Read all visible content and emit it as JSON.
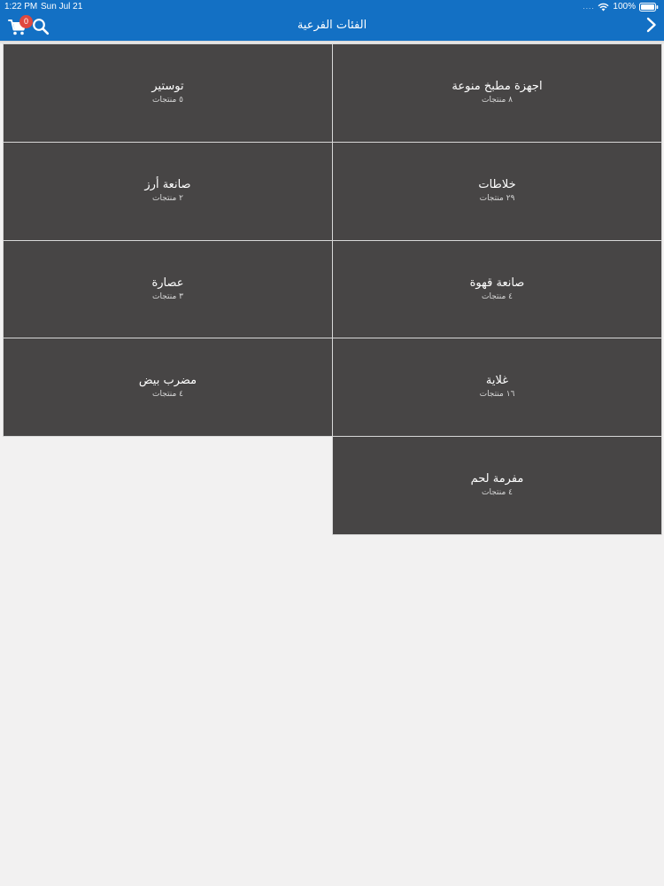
{
  "status": {
    "time": "1:22 PM",
    "date": "Sun Jul 21",
    "signal": "....",
    "battery": "100%"
  },
  "header": {
    "title": "الفئات الفرعية",
    "cart_count": "0"
  },
  "icons": {
    "back": "chevron-right-icon",
    "search": "search-icon",
    "cart": "cart-icon"
  },
  "colors": {
    "accent": "#1370c4",
    "tile": "#474545",
    "badge": "#e0483e",
    "background": "#f2f1f1"
  },
  "categories": [
    {
      "name": "اجهزة مطبخ منوعة",
      "count": "٨ منتجات"
    },
    {
      "name": "توستير",
      "count": "٥ منتجات"
    },
    {
      "name": "خلاطات",
      "count": "٢٩ منتجات"
    },
    {
      "name": "صانعة أرز",
      "count": "٢ منتجات"
    },
    {
      "name": "صانعة قهوة",
      "count": "٤ منتجات"
    },
    {
      "name": "عصارة",
      "count": "٣ منتجات"
    },
    {
      "name": "غلاية",
      "count": "١٦ منتجات"
    },
    {
      "name": "مضرب بيض",
      "count": "٤ منتجات"
    },
    {
      "name": "مفرمة لحم",
      "count": "٤ منتجات"
    }
  ]
}
